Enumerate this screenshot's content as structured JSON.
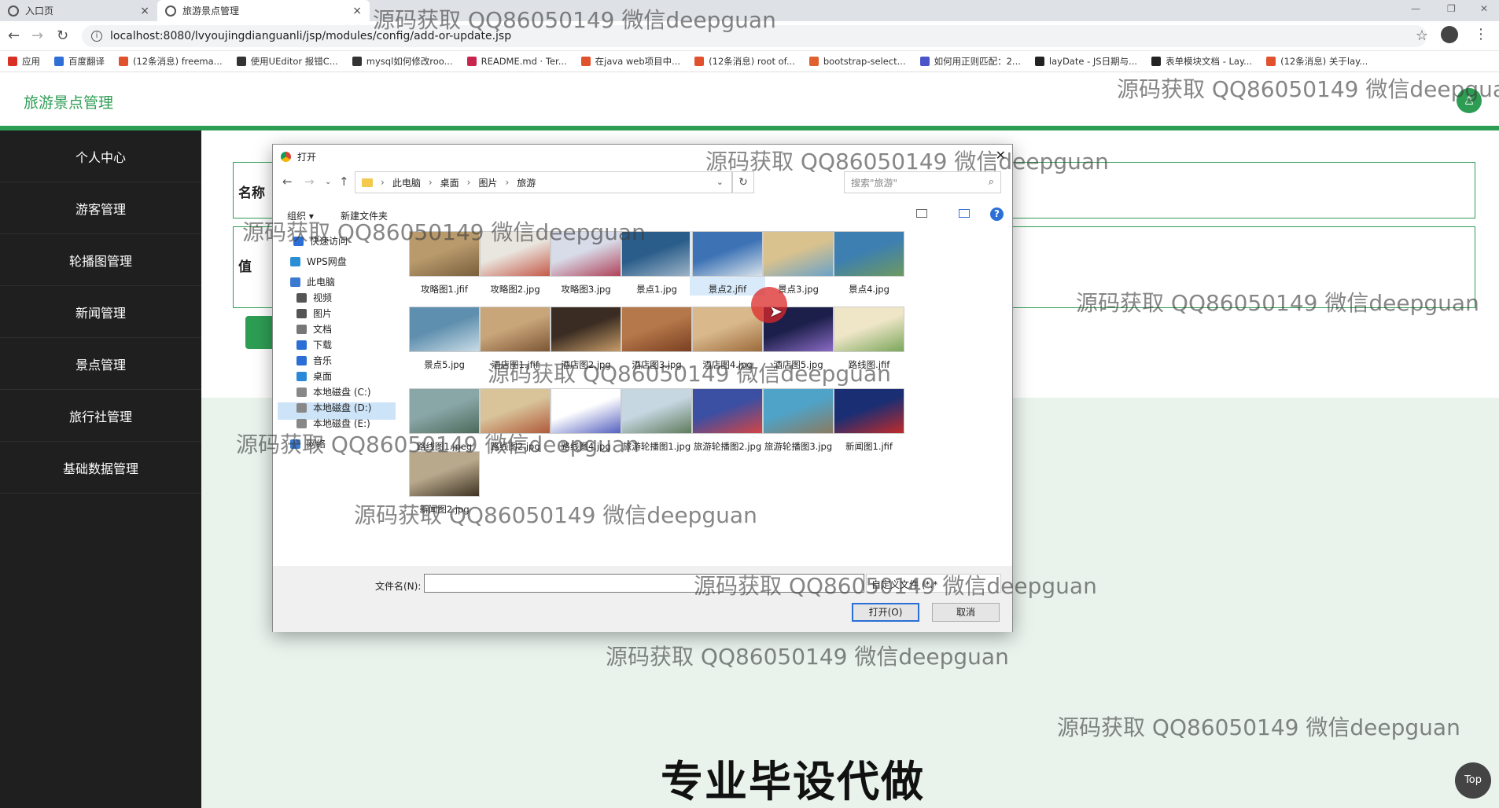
{
  "browser": {
    "tabs": [
      {
        "label": "入口页"
      },
      {
        "label": "旅游景点管理"
      }
    ],
    "url": "localhost:8080/lvyoujingdianguanli/jsp/modules/config/add-or-update.jsp",
    "bookmarks": [
      {
        "label": "应用",
        "color": "#d93025"
      },
      {
        "label": "百度翻译",
        "color": "#2f6fd6"
      },
      {
        "label": "(12条消息) freema...",
        "color": "#e0522e"
      },
      {
        "label": "使用UEditor 报错C...",
        "color": "#333333"
      },
      {
        "label": "mysql如何修改roo...",
        "color": "#333333"
      },
      {
        "label": "README.md · Ter...",
        "color": "#c7254e"
      },
      {
        "label": "在java web项目中...",
        "color": "#e0522e"
      },
      {
        "label": "(12条消息) root of...",
        "color": "#e0522e"
      },
      {
        "label": "bootstrap-select...",
        "color": "#e06030"
      },
      {
        "label": "如何用正则匹配：2...",
        "color": "#4a55c9"
      },
      {
        "label": "layDate - JS日期与...",
        "color": "#222222"
      },
      {
        "label": "表单模块文档 - Lay...",
        "color": "#222222"
      },
      {
        "label": "(12条消息) 关于lay...",
        "color": "#e0522e"
      }
    ]
  },
  "app": {
    "title": "旅游景点管理",
    "user_icon_glyph": "♙",
    "accent": "#2e9d54",
    "sidebar": [
      {
        "label": "个人中心"
      },
      {
        "label": "游客管理"
      },
      {
        "label": "轮播图管理"
      },
      {
        "label": "新闻管理"
      },
      {
        "label": "景点管理"
      },
      {
        "label": "旅行社管理"
      },
      {
        "label": "基础数据管理"
      }
    ],
    "form": {
      "name_label": "名称",
      "value_label": "值"
    },
    "promo_text": "专业毕设代做",
    "top_button": "Top"
  },
  "dialog": {
    "title": "打开",
    "breadcrumb": [
      "此电脑",
      "桌面",
      "图片",
      "旅游"
    ],
    "search_placeholder": "搜索\"旅游\"",
    "toolbar": {
      "organize": "组织 ▾",
      "new_folder": "新建文件夹"
    },
    "nav": [
      {
        "label": "快速访问",
        "icon": "star-icon"
      },
      {
        "label": "WPS网盘",
        "icon": "cloud-icon"
      },
      {
        "label": "此电脑",
        "icon": "computer-icon"
      },
      {
        "label": "视频",
        "icon": "video-icon"
      },
      {
        "label": "图片",
        "icon": "picture-icon"
      },
      {
        "label": "文档",
        "icon": "document-icon"
      },
      {
        "label": "下载",
        "icon": "download-icon"
      },
      {
        "label": "音乐",
        "icon": "music-icon"
      },
      {
        "label": "桌面",
        "icon": "desktop-icon"
      },
      {
        "label": "本地磁盘 (C:)",
        "icon": "disk-icon"
      },
      {
        "label": "本地磁盘 (D:)",
        "icon": "disk-icon"
      },
      {
        "label": "本地磁盘 (E:)",
        "icon": "disk-icon"
      },
      {
        "label": "网络",
        "icon": "network-icon"
      }
    ],
    "files": [
      {
        "name": "攻略图1.jfif",
        "colors": [
          "#b89a6c",
          "#7a5f3c"
        ]
      },
      {
        "name": "攻略图2.jpg",
        "colors": [
          "#e9e6df",
          "#c65a4a"
        ]
      },
      {
        "name": "攻略图3.jpg",
        "colors": [
          "#d8dbe8",
          "#b0425a"
        ]
      },
      {
        "name": "景点1.jpg",
        "colors": [
          "#2a5d8a",
          "#9fb5c8"
        ]
      },
      {
        "name": "景点2.jfif",
        "colors": [
          "#3d73b5",
          "#d8e2ea"
        ]
      },
      {
        "name": "景点3.jpg",
        "colors": [
          "#d9c28e",
          "#6aa2c7"
        ]
      },
      {
        "name": "景点4.jpg",
        "colors": [
          "#3d7fb0",
          "#6e9960"
        ]
      },
      {
        "name": "景点5.jpg",
        "colors": [
          "#5f8fae",
          "#c9dbe6"
        ]
      },
      {
        "name": "酒店图1.jfif",
        "colors": [
          "#c9a57a",
          "#7c5635"
        ]
      },
      {
        "name": "酒店图2.jpg",
        "colors": [
          "#3a2c22",
          "#c79c68"
        ]
      },
      {
        "name": "酒店图3.jpg",
        "colors": [
          "#b5784a",
          "#7a3f22"
        ]
      },
      {
        "name": "酒店图4.jpg",
        "colors": [
          "#d9b98c",
          "#9c6a3b"
        ]
      },
      {
        "name": "酒店图5.jpg",
        "colors": [
          "#1c1f4a",
          "#8b6bc5"
        ]
      },
      {
        "name": "路线图.jfif",
        "colors": [
          "#efe6c8",
          "#7aa65a"
        ]
      },
      {
        "name": "路线图1.jpeg",
        "colors": [
          "#8aa7a8",
          "#4c6a5a"
        ]
      },
      {
        "name": "路线图2.jpg",
        "colors": [
          "#d9c49a",
          "#b05a3a"
        ]
      },
      {
        "name": "路线图4.jpg",
        "colors": [
          "#ffffff",
          "#5561c0"
        ]
      },
      {
        "name": "旅游轮播图1.jpg",
        "colors": [
          "#c7d7e2",
          "#5e7b5c"
        ]
      },
      {
        "name": "旅游轮播图2.jpg",
        "colors": [
          "#3b4fa3",
          "#d44444"
        ]
      },
      {
        "name": "旅游轮播图3.jpg",
        "colors": [
          "#4fa3c8",
          "#8a7a60"
        ]
      },
      {
        "name": "新闻图1.jfif",
        "colors": [
          "#1a2e73",
          "#c12a2a"
        ]
      },
      {
        "name": "新闻图2.jpg",
        "colors": [
          "#b9a98c",
          "#3e3324"
        ]
      }
    ],
    "file_name_label": "文件名(N):",
    "file_name_value": "",
    "file_type": "自定义文件 (*.*",
    "open_button": "打开(O)",
    "cancel_button": "取消"
  },
  "watermark": "源码获取 QQ86050149 微信deepguan"
}
